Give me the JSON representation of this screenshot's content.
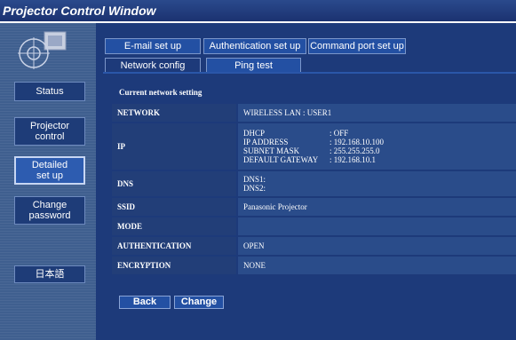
{
  "window": {
    "title": "Projector Control Window"
  },
  "sidebar": {
    "items": [
      {
        "label_lines": [
          "Status"
        ]
      },
      {
        "label_lines": [
          "Projector",
          "control"
        ]
      },
      {
        "label_lines": [
          "Detailed",
          "set up"
        ]
      },
      {
        "label_lines": [
          "Change",
          "password"
        ]
      },
      {
        "label_lines": [
          "日本語"
        ]
      }
    ],
    "active_index": 2
  },
  "tabs": {
    "row1": [
      "E-mail set up",
      "Authentication set up",
      "Command port set up"
    ],
    "row2": [
      "Network config",
      "Ping test"
    ],
    "selected": "Network config"
  },
  "section_title": "Current network setting",
  "rows": {
    "network": {
      "label": "NETWORK",
      "value": "WIRELESS LAN : USER1"
    },
    "ip": {
      "label": "IP",
      "entries": [
        {
          "k": "DHCP",
          "v": ": OFF"
        },
        {
          "k": "IP ADDRESS",
          "v": ": 192.168.10.100"
        },
        {
          "k": "SUBNET MASK",
          "v": ": 255.255.255.0"
        },
        {
          "k": "DEFAULT GATEWAY",
          "v": ": 192.168.10.1"
        }
      ]
    },
    "dns": {
      "label": "DNS",
      "lines": [
        "DNS1:",
        "DNS2:"
      ]
    },
    "ssid": {
      "label": "SSID",
      "value": "Panasonic Projector"
    },
    "mode": {
      "label": "MODE",
      "value": ""
    },
    "authentication": {
      "label": "AUTHENTICATION",
      "value": "OPEN"
    },
    "encryption": {
      "label": "ENCRYPTION",
      "value": "NONE"
    }
  },
  "buttons": {
    "back": "Back",
    "change": "Change"
  },
  "colors": {
    "title_bar": "#1b3270",
    "main_bg": "#1d3a7a",
    "sidebar_bg": "#3f5f8f",
    "button_bg": "#2350a3"
  }
}
